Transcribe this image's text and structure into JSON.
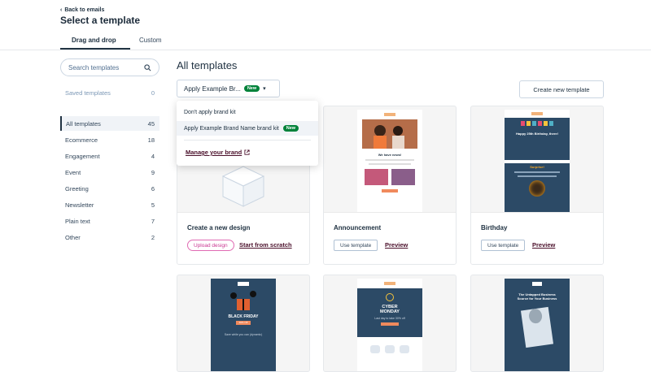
{
  "header": {
    "back_label": "Back to emails",
    "title": "Select a template",
    "tabs": [
      {
        "label": "Drag and drop"
      },
      {
        "label": "Custom"
      }
    ]
  },
  "sidebar": {
    "search_placeholder": "Search templates",
    "saved": {
      "label": "Saved templates",
      "count": "0"
    },
    "categories": [
      {
        "label": "All templates",
        "count": "45"
      },
      {
        "label": "Ecommerce",
        "count": "18"
      },
      {
        "label": "Engagement",
        "count": "4"
      },
      {
        "label": "Event",
        "count": "9"
      },
      {
        "label": "Greeting",
        "count": "6"
      },
      {
        "label": "Newsletter",
        "count": "5"
      },
      {
        "label": "Plain text",
        "count": "7"
      },
      {
        "label": "Other",
        "count": "2"
      }
    ]
  },
  "main": {
    "title": "All templates",
    "brand_select": {
      "value": "Apply Example Br...",
      "badge": "New"
    },
    "create_button": "Create new template"
  },
  "dropdown": {
    "items": [
      {
        "label": "Don't apply brand kit"
      },
      {
        "label": "Apply Example Brand Name brand kit",
        "badge": "New"
      }
    ],
    "manage_label": "Manage your brand"
  },
  "cards": [
    {
      "title": "Create a new design",
      "upload_label": "Upload design",
      "scratch_label": "Start from scratch"
    },
    {
      "title": "Announcement",
      "use_label": "Use template",
      "preview_label": "Preview",
      "thumb_text": "We have news!"
    },
    {
      "title": "Birthday",
      "use_label": "Use template",
      "preview_label": "Preview",
      "thumb_heading": "Happy 25th Birthday, there!",
      "thumb_sub": "Surprise!"
    }
  ],
  "row2": [
    {
      "thumb_text": "BLACK FRIDAY",
      "thumb_badge": "30% Off",
      "thumb_sub": "Save while you can (dynamic)"
    },
    {
      "thumb_text": "CYBER MONDAY",
      "thumb_sub": "Last day to take 30% off"
    },
    {
      "thumb_text": "The Untapped Business Source for Your Business"
    }
  ],
  "colors": {
    "accent": "#4a0f2a",
    "navy": "#2c4a66",
    "new_badge": "#00823a"
  }
}
